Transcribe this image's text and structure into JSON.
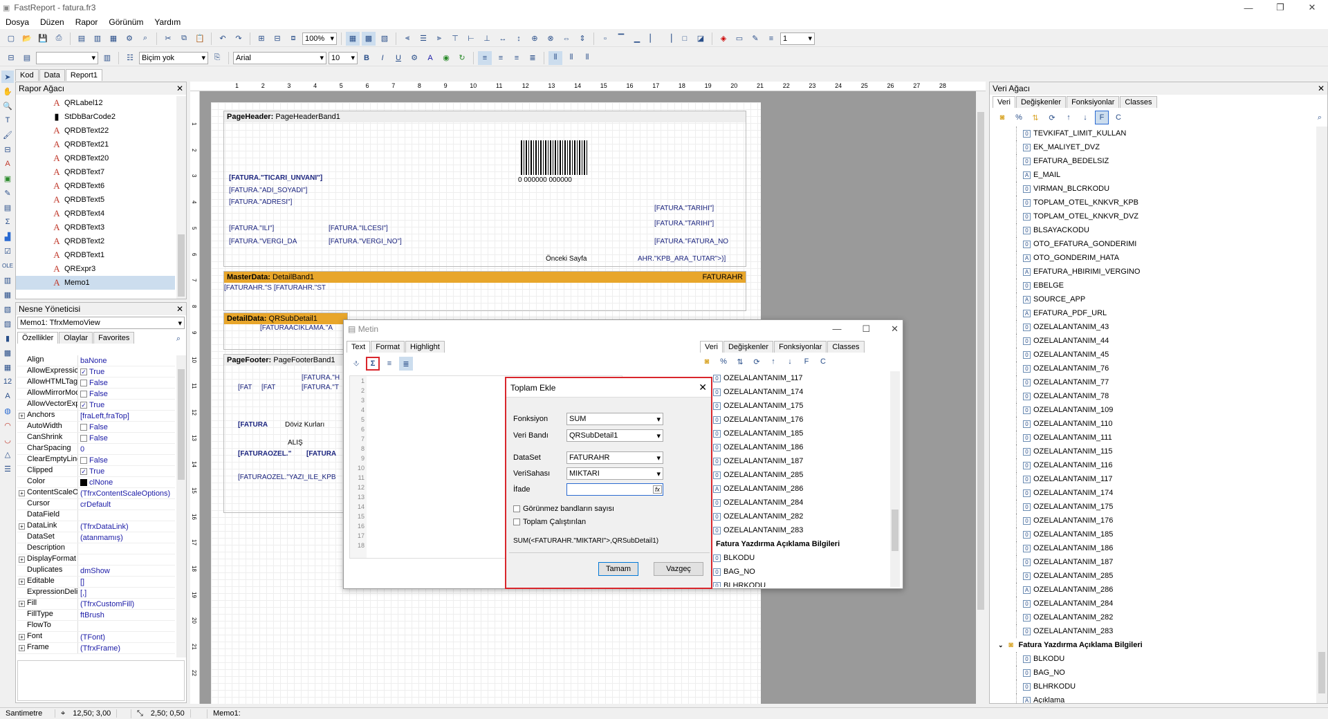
{
  "window": {
    "title": "FastReport - fatura.fr3",
    "min": "—",
    "max": "❐",
    "close": "✕"
  },
  "menu": [
    "Dosya",
    "Düzen",
    "Rapor",
    "Görünüm",
    "Yardım"
  ],
  "toolbar1": {
    "zoom": "100%",
    "line_width": "1"
  },
  "toolbar2": {
    "style": "Biçim yok",
    "font": "Arial",
    "size": "10"
  },
  "tabs": [
    "Kod",
    "Data",
    "Report1"
  ],
  "report_tree": {
    "title": "Rapor Ağacı",
    "items": [
      "QRLabel12",
      "StDbBarCode2",
      "QRDBText22",
      "QRDBText21",
      "QRDBText20",
      "QRDBText7",
      "QRDBText6",
      "QRDBText5",
      "QRDBText4",
      "QRDBText3",
      "QRDBText2",
      "QRDBText1",
      "QRExpr3",
      "Memo1"
    ]
  },
  "object_inspector": {
    "title": "Nesne Yöneticisi",
    "object": "Memo1: TfrxMemoView",
    "tabs": [
      "Özellikler",
      "Olaylar",
      "Favorites"
    ],
    "props": [
      {
        "n": "Align",
        "v": "baNone"
      },
      {
        "n": "AllowExpressions",
        "v": "True",
        "cb": "✓"
      },
      {
        "n": "AllowHTMLTags",
        "v": "False",
        "cb": ""
      },
      {
        "n": "AllowMirrorMode",
        "v": "False",
        "cb": ""
      },
      {
        "n": "AllowVectorExport",
        "v": "True",
        "cb": "✓"
      },
      {
        "n": "Anchors",
        "v": "[fraLeft,fraTop]",
        "plus": "+"
      },
      {
        "n": "AutoWidth",
        "v": "False",
        "cb": ""
      },
      {
        "n": "CanShrink",
        "v": "False",
        "cb": ""
      },
      {
        "n": "CharSpacing",
        "v": "0"
      },
      {
        "n": "ClearEmptyLines",
        "v": "False",
        "cb": ""
      },
      {
        "n": "Clipped",
        "v": "True",
        "cb": "✓"
      },
      {
        "n": "Color",
        "v": "clNone",
        "sw": "#000"
      },
      {
        "n": "ContentScaleOptions",
        "v": "(TfrxContentScaleOptions)",
        "plus": "+"
      },
      {
        "n": "Cursor",
        "v": "crDefault"
      },
      {
        "n": "DataField",
        "v": ""
      },
      {
        "n": "DataLink",
        "v": "(TfrxDataLink)",
        "plus": "+"
      },
      {
        "n": "DataSet",
        "v": "(atanmamış)"
      },
      {
        "n": "Description",
        "v": ""
      },
      {
        "n": "DisplayFormat",
        "v": "",
        "plus": "+"
      },
      {
        "n": "Duplicates",
        "v": "dmShow"
      },
      {
        "n": "Editable",
        "v": "[]",
        "plus": "+"
      },
      {
        "n": "ExpressionDelimiters",
        "v": "[,]"
      },
      {
        "n": "Fill",
        "v": "(TfrxCustomFill)",
        "plus": "+"
      },
      {
        "n": "FillType",
        "v": "ftBrush"
      },
      {
        "n": "FlowTo",
        "v": ""
      },
      {
        "n": "Font",
        "v": "(TFont)",
        "plus": "+"
      },
      {
        "n": "Frame",
        "v": "(TfrxFrame)",
        "plus": "+"
      }
    ]
  },
  "designer": {
    "ruler": [
      "1",
      "2",
      "3",
      "4",
      "5",
      "6",
      "7",
      "8",
      "9",
      "10",
      "11",
      "12",
      "13",
      "14",
      "15",
      "16",
      "17",
      "18",
      "19",
      "20",
      "21",
      "22",
      "23",
      "24",
      "25",
      "26",
      "27",
      "28"
    ],
    "page_header": "PageHeader:",
    "page_header_name": "PageHeaderBand1",
    "barcode_text": "0 000000 000000",
    "fields_header": [
      "[FATURA.\"TICARI_UNVANI\"]",
      "[FATURA.\"ADI_SOYADI\"]",
      "[FATURA.\"ADRESI\"]",
      "[FATURA.\"ILI\"]",
      "[FATURA.\"ILCESI\"]",
      "[FATURA.\"VERGI_DA",
      "[FATURA.\"VERGI_NO\"]",
      "[FATURA.\"TARIHI\"]",
      "[FATURA.\"TARIHI\"]",
      "[FATURA.\"FATURA_NO",
      "Önceki Sayfa",
      "AHR.\"KPB_ARA_TUTAR\">)]"
    ],
    "master": "MasterData:",
    "master_name": "DetailBand1",
    "master_ds": "FATURAHR",
    "master_fields": [
      "[FATURAHR.\"S",
      "[FATURAHR.\"ST"
    ],
    "detail": "DetailData:",
    "detail_name": "QRSubDetail1",
    "detail_field": "[FATURAACIKLAMA.\"A",
    "footer": "PageFooter:",
    "footer_name": "PageFooterBand1",
    "footer_fields": [
      "[FAT",
      "[FAT",
      "[FATURA.\"H",
      "[FATURA.\"T",
      "[FATURA",
      "Döviz Kurları",
      "ALIŞ",
      "[FATURAOZEL.\"",
      "[FATURA",
      "[FATURAOZEL.\"YAZI_ILE_KPB"
    ]
  },
  "memo_editor": {
    "title": "Metin",
    "tabs": [
      "Text",
      "Format",
      "Highlight"
    ],
    "lines": [
      "1",
      "2",
      "3",
      "4",
      "5",
      "6",
      "7",
      "8",
      "9",
      "10",
      "11",
      "12",
      "13",
      "14",
      "15",
      "16",
      "17",
      "18"
    ],
    "tree_tabs": [
      "Veri",
      "Değişkenler",
      "Fonksiyonlar",
      "Classes"
    ],
    "tree": [
      "OZELALANTANIM_117",
      "OZELALANTANIM_174",
      "OZELALANTANIM_175",
      "OZELALANTANIM_176",
      "OZELALANTANIM_185",
      "OZELALANTANIM_186",
      "OZELALANTANIM_187",
      "OZELALANTANIM_285",
      "OZELALANTANIM_286",
      "OZELALANTANIM_284",
      "OZELALANTANIM_282",
      "OZELALANTANIM_283"
    ],
    "tree_group": "Fatura Yazdırma Açıklama Bilgileri",
    "tree_after": [
      "BLKODU",
      "BAG_NO",
      "BLHRKODU"
    ]
  },
  "sum_dialog": {
    "title": "Toplam Ekle",
    "fonksiyon_label": "Fonksiyon",
    "fonksiyon": "SUM",
    "band_label": "Veri Bandı",
    "band": "QRSubDetail1",
    "dataset_label": "DataSet",
    "dataset": "FATURAHR",
    "field_label": "VeriSahası",
    "field": "MIKTARI",
    "expr_label": "İfade",
    "expr": "",
    "chk1": "Görünmez bandların sayısı",
    "chk2": "Toplam Çalıştırılan",
    "result": "SUM(<FATURAHR.\"MIKTARI\">,QRSubDetail1)",
    "ok": "Tamam",
    "cancel": "Vazgeç"
  },
  "data_tree": {
    "title": "Veri Ağacı",
    "tabs": [
      "Veri",
      "Değişkenler",
      "Fonksiyonlar",
      "Classes"
    ],
    "items": [
      {
        "t": "TEVKIFAT_LIMIT_KULLAN",
        "i": "0"
      },
      {
        "t": "EK_MALIYET_DVZ",
        "i": "0"
      },
      {
        "t": "EFATURA_BEDELSIZ",
        "i": "0"
      },
      {
        "t": "E_MAIL",
        "i": "A"
      },
      {
        "t": "VIRMAN_BLCRKODU",
        "i": "0"
      },
      {
        "t": "TOPLAM_OTEL_KNKVR_KPB",
        "i": "0"
      },
      {
        "t": "TOPLAM_OTEL_KNKVR_DVZ",
        "i": "0"
      },
      {
        "t": "BLSAYACKODU",
        "i": "0"
      },
      {
        "t": "OTO_EFATURA_GONDERIMI",
        "i": "0"
      },
      {
        "t": "OTO_GONDERIM_HATA",
        "i": "A"
      },
      {
        "t": "EFATURA_HBIRIMI_VERGINO",
        "i": "A"
      },
      {
        "t": "EBELGE",
        "i": "0"
      },
      {
        "t": "SOURCE_APP",
        "i": "A"
      },
      {
        "t": "EFATURA_PDF_URL",
        "i": "A"
      },
      {
        "t": "OZELALANTANIM_43",
        "i": "0"
      },
      {
        "t": "OZELALANTANIM_44",
        "i": "0"
      },
      {
        "t": "OZELALANTANIM_45",
        "i": "0"
      },
      {
        "t": "OZELALANTANIM_76",
        "i": "0"
      },
      {
        "t": "OZELALANTANIM_77",
        "i": "0"
      },
      {
        "t": "OZELALANTANIM_78",
        "i": "0"
      },
      {
        "t": "OZELALANTANIM_109",
        "i": "0"
      },
      {
        "t": "OZELALANTANIM_110",
        "i": "0"
      },
      {
        "t": "OZELALANTANIM_111",
        "i": "0"
      },
      {
        "t": "OZELALANTANIM_115",
        "i": "0"
      },
      {
        "t": "OZELALANTANIM_116",
        "i": "0"
      },
      {
        "t": "OZELALANTANIM_117",
        "i": "0"
      },
      {
        "t": "OZELALANTANIM_174",
        "i": "0"
      },
      {
        "t": "OZELALANTANIM_175",
        "i": "0"
      },
      {
        "t": "OZELALANTANIM_176",
        "i": "0"
      },
      {
        "t": "OZELALANTANIM_185",
        "i": "0"
      },
      {
        "t": "OZELALANTANIM_186",
        "i": "0"
      },
      {
        "t": "OZELALANTANIM_187",
        "i": "0"
      },
      {
        "t": "OZELALANTANIM_285",
        "i": "0"
      },
      {
        "t": "OZELALANTANIM_286",
        "i": "A"
      },
      {
        "t": "OZELALANTANIM_284",
        "i": "0"
      },
      {
        "t": "OZELALANTANIM_282",
        "i": "0"
      },
      {
        "t": "OZELALANTANIM_283",
        "i": "0"
      }
    ],
    "group": "Fatura Yazdırma Açıklama Bilgileri",
    "group_items": [
      {
        "t": "BLKODU",
        "i": "0"
      },
      {
        "t": "BAG_NO",
        "i": "0"
      },
      {
        "t": "BLHRKODU",
        "i": "0"
      },
      {
        "t": "Açıklama",
        "i": "A"
      }
    ]
  },
  "status": {
    "unit": "Santimetre",
    "pos": "12,50; 3,00",
    "size": "2,50; 0,50",
    "obj": "Memo1:"
  }
}
